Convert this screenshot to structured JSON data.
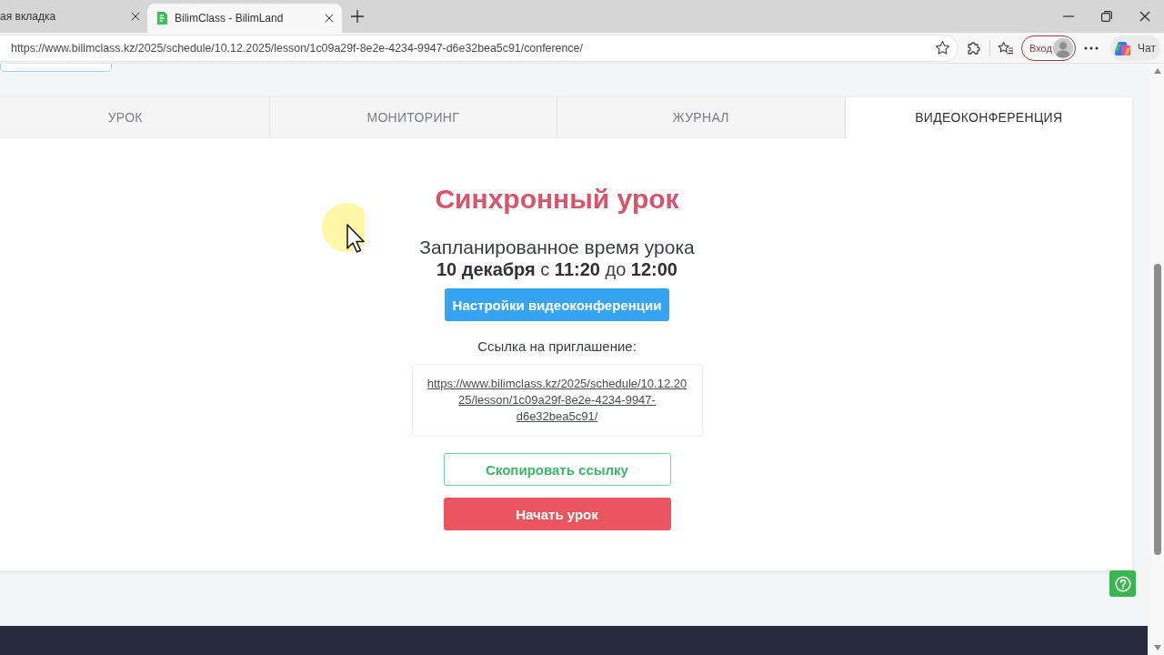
{
  "browser": {
    "tabs": [
      {
        "title": "ая вкладка",
        "selected": false
      },
      {
        "title": "BilimClass - BilimLand",
        "selected": true,
        "favicon": true
      }
    ],
    "address": "https://www.bilimclass.kz/2025/schedule/10.12.2025/lesson/1c09a29f-8e2e-4234-9947-d6e32bea5c91/conference/",
    "sign_in": "Вход",
    "chat": "Чат"
  },
  "page": {
    "tabs": [
      {
        "label": "УРОК",
        "selected": false
      },
      {
        "label": "МОНИТОРИНГ",
        "selected": false
      },
      {
        "label": "ЖУРНАЛ",
        "selected": false
      },
      {
        "label": "ВИДЕОКОНФЕРЕНЦИЯ",
        "selected": true
      }
    ],
    "title": "Синхронный урок",
    "schedule_label": "Запланированное время урока",
    "schedule_time": "**10 декабря** с **11:20** до **12:00**",
    "settings_button": "Настройки видеоконференции",
    "invite_label": "Ссылка на приглашение:",
    "invite_link": "https://www.bilimclass.kz/2025/schedule/10.12.2025/lesson/1c09a29f-8e2e-4234-9947-d6e32bea5c91/",
    "copy_button": "Скопировать ссылку",
    "start_button": "Начать урок"
  }
}
